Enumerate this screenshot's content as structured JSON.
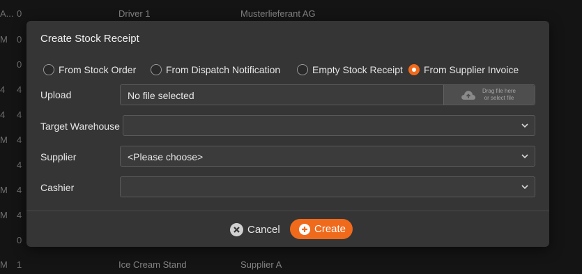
{
  "background_rows": [
    {
      "c0": "A...",
      "c1": "0",
      "c2": "Driver 1",
      "c3": "Musterlieferant AG"
    },
    {
      "c0": "M",
      "c1": "0",
      "c2": "",
      "c3": ""
    },
    {
      "c0": "",
      "c1": "0",
      "c2": "",
      "c3": ""
    },
    {
      "c0": "4",
      "c1": "4",
      "c2": "",
      "c3": ""
    },
    {
      "c0": "4",
      "c1": "4",
      "c2": "",
      "c3": ""
    },
    {
      "c0": "M",
      "c1": "4",
      "c2": "",
      "c3": ""
    },
    {
      "c0": "",
      "c1": "4",
      "c2": "",
      "c3": ""
    },
    {
      "c0": "M",
      "c1": "4",
      "c2": "",
      "c3": ""
    },
    {
      "c0": "M",
      "c1": "4",
      "c2": "",
      "c3": ""
    },
    {
      "c0": "",
      "c1": "0",
      "c2": "",
      "c3": ""
    },
    {
      "c0": "M",
      "c1": "1",
      "c2": "Ice Cream Stand",
      "c3": "Supplier A"
    }
  ],
  "dialog": {
    "title": "Create Stock Receipt",
    "radio_options": [
      {
        "label": "From Stock Order",
        "checked": false
      },
      {
        "label": "From Dispatch Notification",
        "checked": false
      },
      {
        "label": "Empty Stock Receipt",
        "checked": false
      },
      {
        "label": "From Supplier Invoice",
        "checked": true
      }
    ],
    "upload": {
      "label": "Upload",
      "value": "No file selected",
      "drop_line1": "Drag file here",
      "drop_line2": "or select file"
    },
    "target_warehouse": {
      "label": "Target Warehouse",
      "value": ""
    },
    "supplier": {
      "label": "Supplier",
      "value": "<Please choose>"
    },
    "cashier": {
      "label": "Cashier",
      "value": ""
    },
    "cancel_label": "Cancel",
    "create_label": "Create"
  },
  "colors": {
    "accent": "#f06a1c",
    "dialog_bg": "#353535",
    "page_bg": "#1d1d1d"
  },
  "icons": [
    "cloud-upload-icon",
    "chevron-down-icon",
    "close-circle-icon",
    "plus-circle-icon"
  ]
}
